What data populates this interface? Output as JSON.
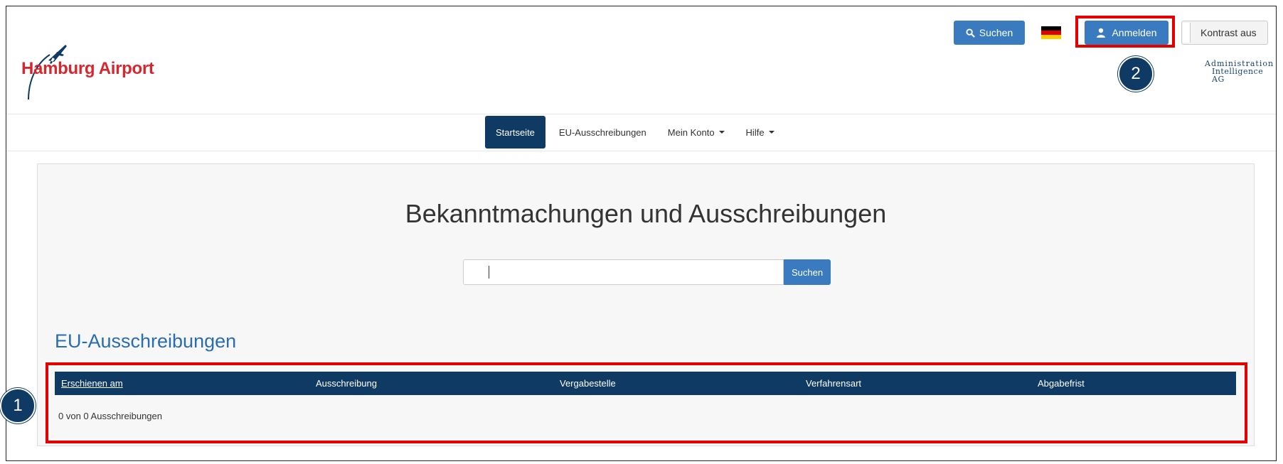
{
  "header": {
    "logo_text": "Hamburg Airport",
    "search_button": "Suchen",
    "login_button": "Anmelden",
    "contrast_button": "Kontrast aus",
    "partner_logo_line1": "Administration",
    "partner_logo_line2": "Intelligence AG",
    "flag_colors": [
      "#000000",
      "#dd0000",
      "#ffce00"
    ]
  },
  "nav": {
    "items": [
      {
        "label": "Startseite",
        "active": true
      },
      {
        "label": "EU-Ausschreibungen",
        "active": false
      },
      {
        "label": "Mein Konto",
        "dropdown": true
      },
      {
        "label": "Hilfe",
        "dropdown": true
      }
    ]
  },
  "main": {
    "headline": "Bekanntmachungen und Ausschreibungen",
    "search_placeholder": "",
    "search_button": "Suchen",
    "section_title": "EU-Ausschreibungen",
    "table": {
      "columns": [
        "Erschienen am",
        "Ausschreibung",
        "Vergabestelle",
        "Verfahrensart",
        "Abgabefrist"
      ]
    },
    "result_count": "0 von 0 Ausschreibungen"
  },
  "annotations": {
    "marker_1": "1",
    "marker_2": "2",
    "highlight_color": "#e50000",
    "marker_color": "#0e3a63"
  },
  "colors": {
    "primary": "#3a7bbf",
    "dark_navy": "#0e3a63",
    "brand_red": "#d8262e",
    "link_blue": "#2a6cb0"
  }
}
